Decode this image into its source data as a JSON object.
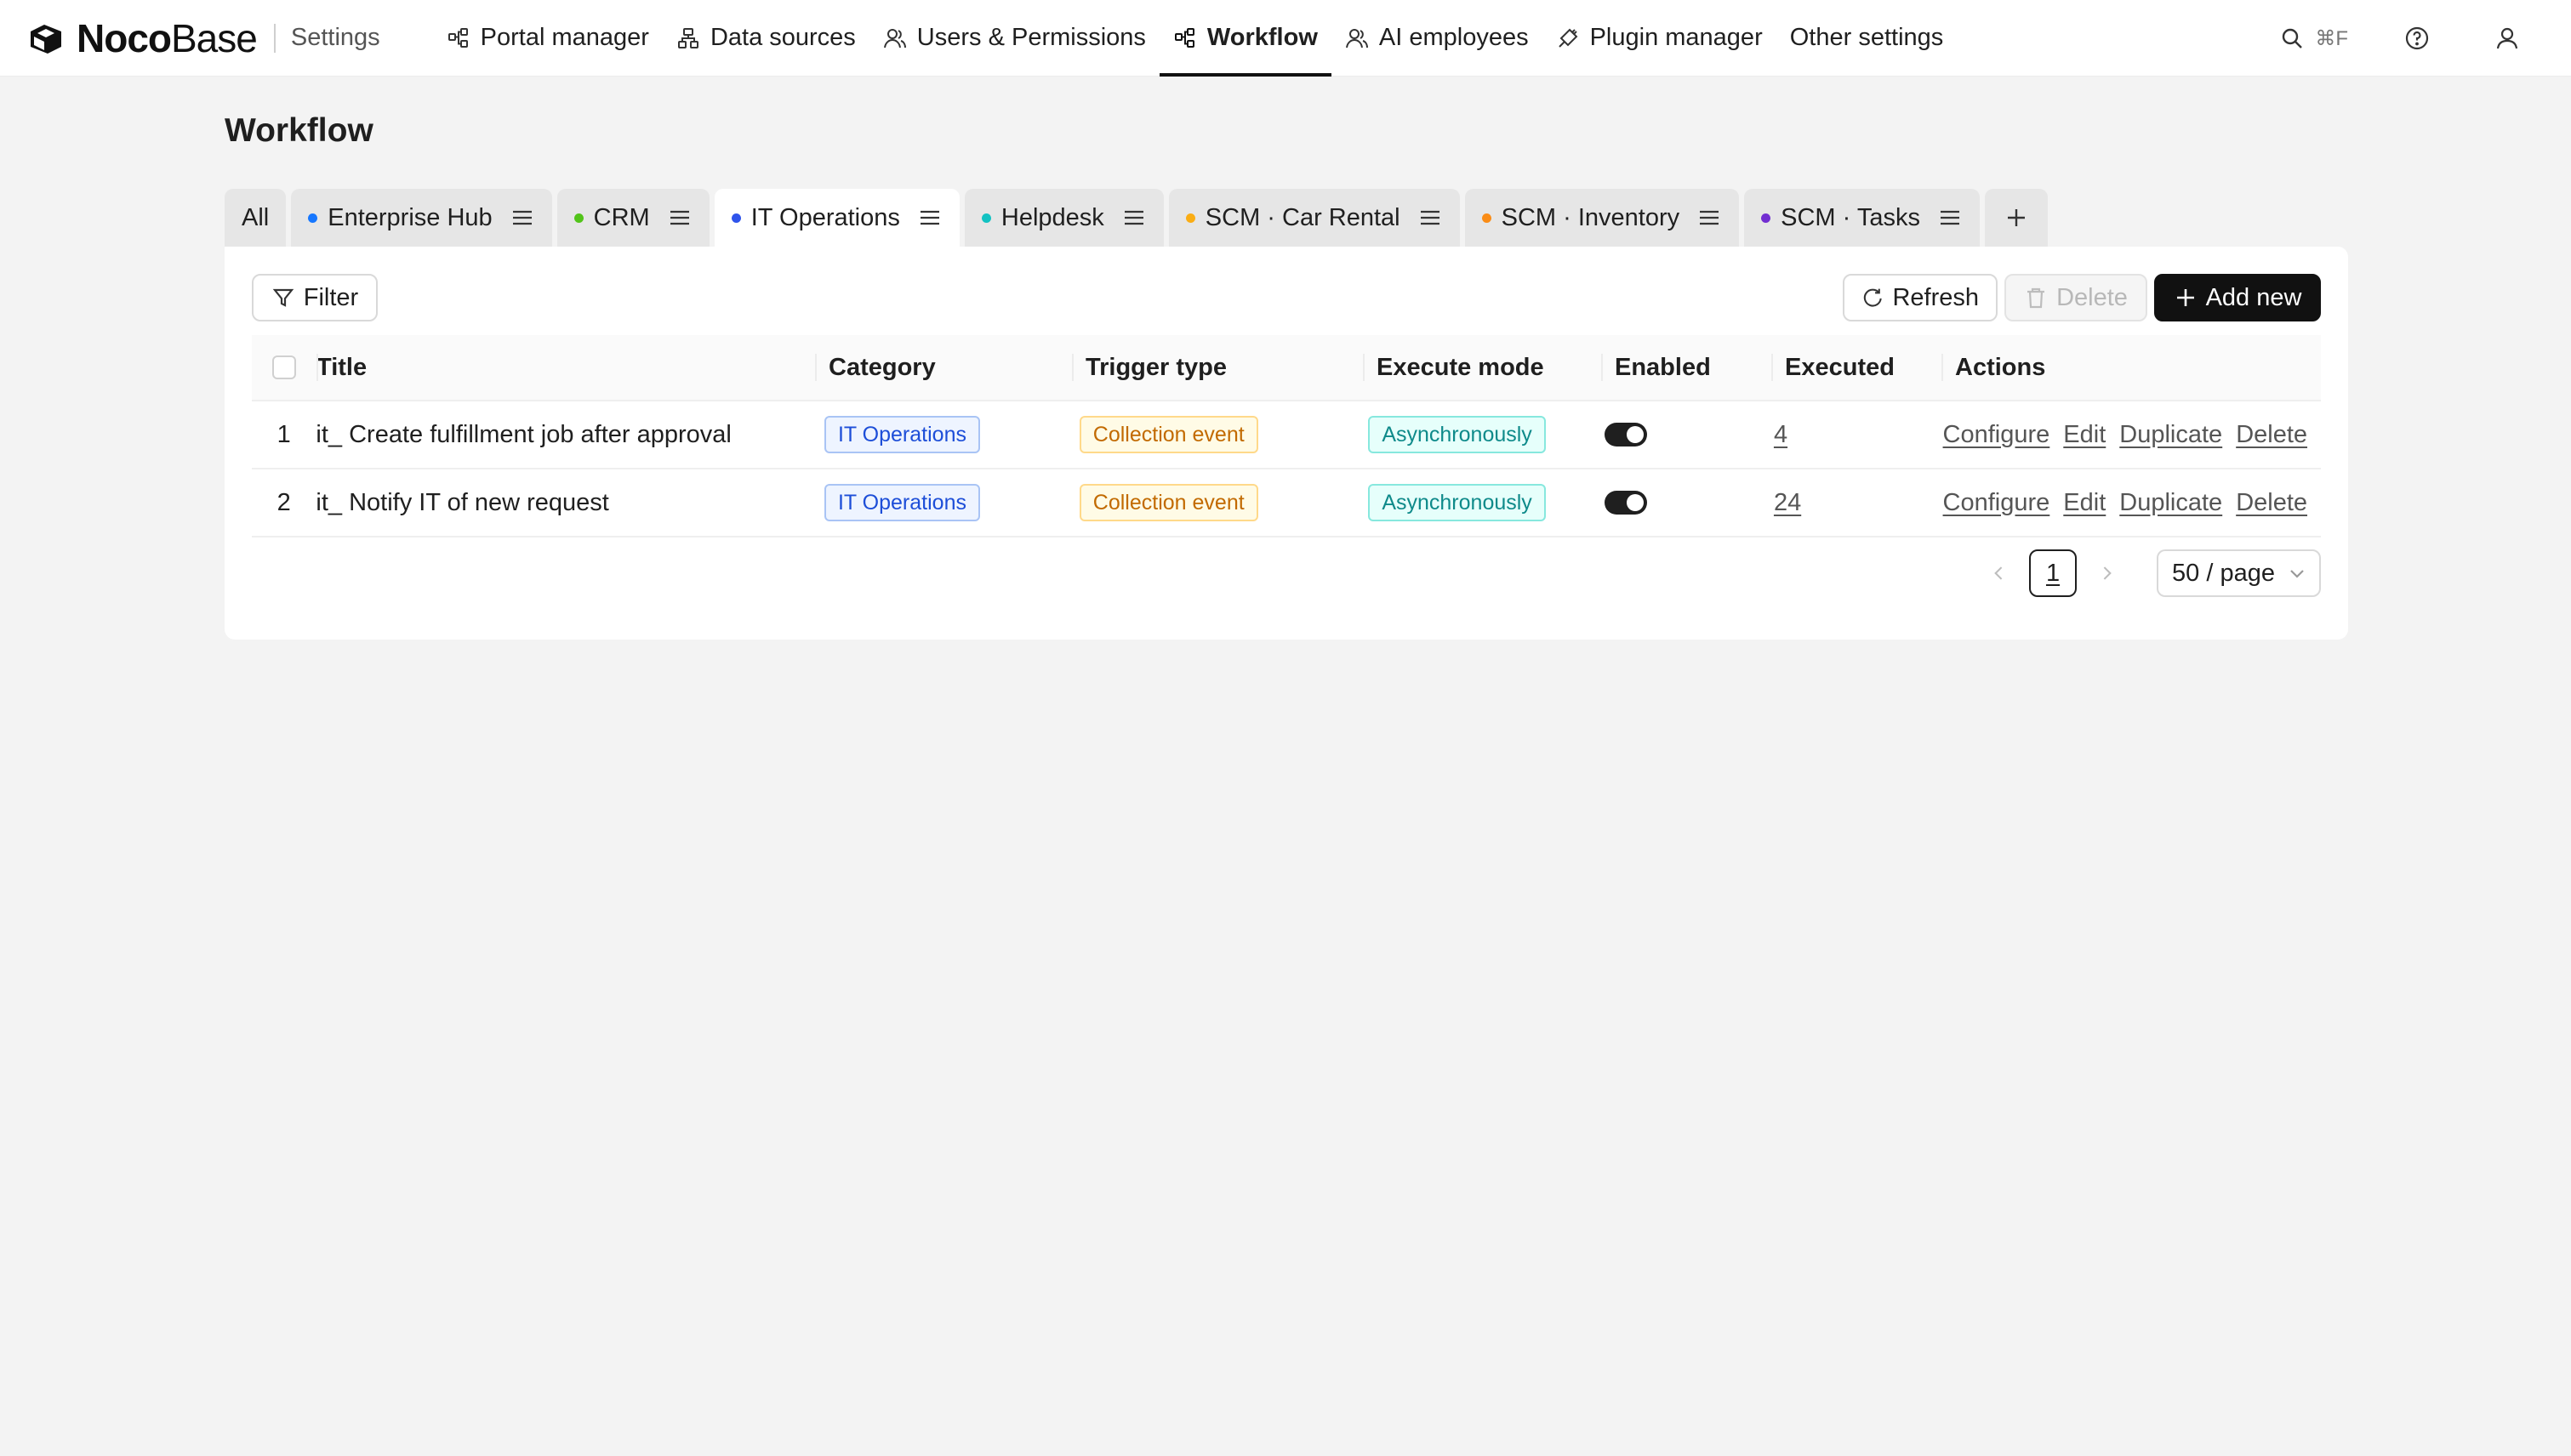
{
  "brand": {
    "name_bold": "Noco",
    "name_light": "Base",
    "section": "Settings"
  },
  "nav": [
    {
      "label": "Portal manager",
      "icon": "portal-icon"
    },
    {
      "label": "Data sources",
      "icon": "data-sources-icon"
    },
    {
      "label": "Users & Permissions",
      "icon": "users-icon"
    },
    {
      "label": "Workflow",
      "icon": "workflow-icon",
      "active": true
    },
    {
      "label": "AI employees",
      "icon": "ai-employees-icon"
    },
    {
      "label": "Plugin manager",
      "icon": "plugin-icon"
    },
    {
      "label": "Other settings"
    }
  ],
  "top_right": {
    "search_shortcut": "⌘F"
  },
  "page": {
    "title": "Workflow"
  },
  "tabs": [
    {
      "label": "All"
    },
    {
      "label": "Enterprise Hub",
      "dot": "#1677ff"
    },
    {
      "label": "CRM",
      "dot": "#52c41a"
    },
    {
      "label": "IT Operations",
      "dot": "#2f54eb",
      "active": true
    },
    {
      "label": "Helpdesk",
      "dot": "#13c2c2"
    },
    {
      "label": "SCM · Car Rental",
      "dot": "#faad14"
    },
    {
      "label": "SCM · Inventory",
      "dot": "#fa8c16"
    },
    {
      "label": "SCM · Tasks",
      "dot": "#722ed1"
    }
  ],
  "toolbar": {
    "filter": "Filter",
    "refresh": "Refresh",
    "delete": "Delete",
    "add_new": "Add new"
  },
  "table": {
    "columns": [
      "Title",
      "Category",
      "Trigger type",
      "Execute mode",
      "Enabled",
      "Executed",
      "Actions"
    ],
    "rows": [
      {
        "index": "1",
        "title": "it_ Create fulfillment job after approval",
        "category": "IT Operations",
        "trigger": "Collection event",
        "mode": "Asynchronously",
        "enabled": true,
        "executed": "4",
        "actions": [
          "Configure",
          "Edit",
          "Duplicate",
          "Delete"
        ]
      },
      {
        "index": "2",
        "title": "it_ Notify IT of new request",
        "category": "IT Operations",
        "trigger": "Collection event",
        "mode": "Asynchronously",
        "enabled": true,
        "executed": "24",
        "actions": [
          "Configure",
          "Edit",
          "Duplicate",
          "Delete"
        ]
      }
    ]
  },
  "pagination": {
    "current_page": "1",
    "page_size": "50 / page"
  }
}
